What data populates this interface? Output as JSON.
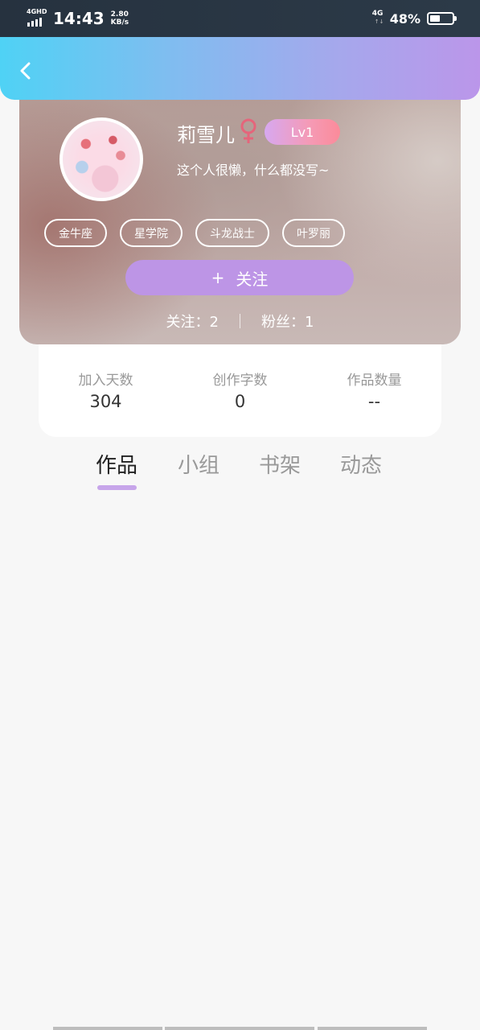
{
  "status_bar": {
    "signal_label": "4GHD",
    "time": "14:43",
    "speed_value": "2.80",
    "speed_unit": "KB/s",
    "network_label": "4G",
    "network_arrows": "↑↓",
    "battery_percent": "48%",
    "battery_level": 0.48
  },
  "header": {
    "back_icon": "chevron-left-icon"
  },
  "profile": {
    "nickname": "莉雪儿",
    "gender_icon": "female-icon",
    "gender_color": "#e5657b",
    "level": "Lv1",
    "bio": "这个人很懒，什么都没写~",
    "tags": [
      "金牛座",
      "星学院",
      "斗龙战士",
      "叶罗丽"
    ],
    "follow_button_plus": "+",
    "follow_button_label": "关注",
    "following_text": "关注：2",
    "fans_text": "粉丝：1"
  },
  "stats": [
    {
      "label": "加入天数",
      "value": "304"
    },
    {
      "label": "创作字数",
      "value": "0"
    },
    {
      "label": "作品数量",
      "value": "--"
    }
  ],
  "tabs": [
    {
      "label": "作品",
      "active": true
    },
    {
      "label": "小组",
      "active": false
    },
    {
      "label": "书架",
      "active": false
    },
    {
      "label": "动态",
      "active": false
    }
  ],
  "colors": {
    "accent": "#bd95e6",
    "tab_indicator": "#c7a5ea",
    "header_start": "#4fd2f5",
    "header_end": "#bb96ea"
  }
}
